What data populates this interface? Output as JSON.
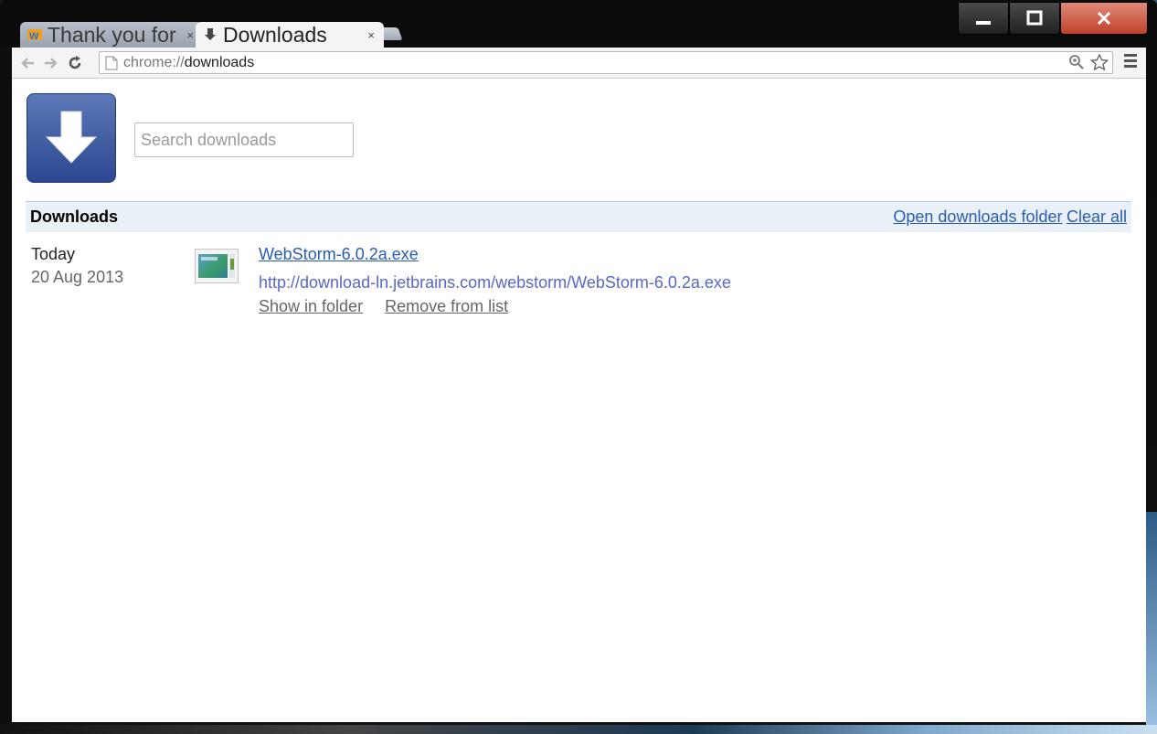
{
  "tabs": [
    {
      "title": "Thank you for",
      "close": "×"
    },
    {
      "title": "Downloads",
      "close": "×"
    }
  ],
  "omnibox": {
    "scheme": "chrome://",
    "host": "downloads"
  },
  "search": {
    "placeholder": "Search downloads"
  },
  "section": {
    "title": "Downloads",
    "open_folder": "Open downloads folder",
    "clear_all": "Clear all"
  },
  "items": [
    {
      "day": "Today",
      "date": "20 Aug 2013",
      "filename": "WebStorm-6.0.2a.exe",
      "url": "http://download-ln.jetbrains.com/webstorm/WebStorm-6.0.2a.exe",
      "show_in_folder": "Show in folder",
      "remove": "Remove from list"
    }
  ],
  "colors": {
    "accent": "#2a5db0",
    "header_bg": "#eaf0f8",
    "logo": "#3a58a0"
  }
}
